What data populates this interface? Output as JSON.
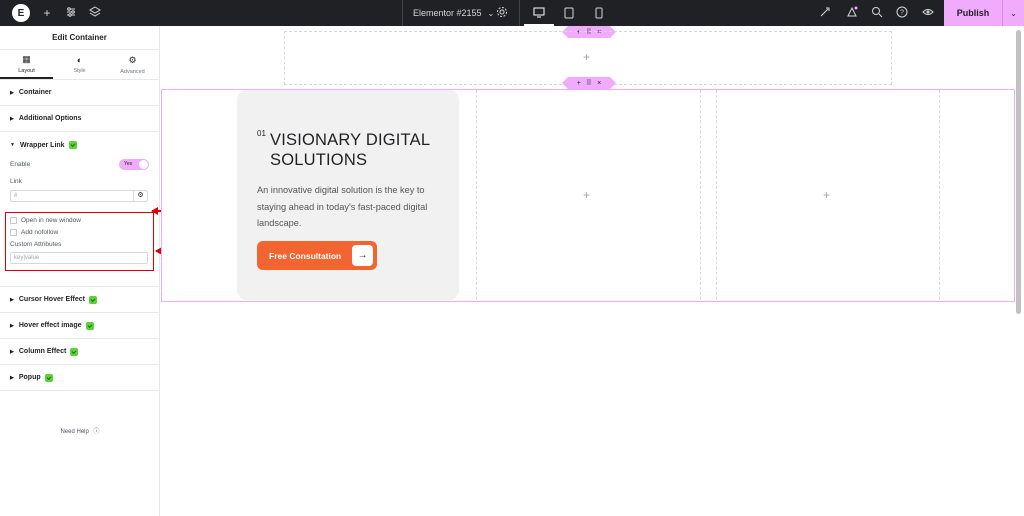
{
  "topbar": {
    "logo_letter": "E",
    "add_icon": "plus-icon",
    "settings_icon": "sliders-icon",
    "layers_icon": "layers-icon",
    "doc_title": "Elementor #2155",
    "doc_chevron": "⌄",
    "page_settings_icon": "gear-icon",
    "devices": [
      "desktop-icon",
      "tablet-icon",
      "mobile-icon"
    ],
    "active_device": "desktop",
    "right_icons": [
      "rocket-icon",
      "notification-icon",
      "search-icon",
      "help-icon",
      "eye-icon"
    ],
    "publish_label": "Publish",
    "publish_menu": "⌄"
  },
  "sidebar": {
    "title": "Edit Container",
    "tabs": [
      {
        "label": "Layout",
        "icon": "▦"
      },
      {
        "label": "Style",
        "icon": "◐"
      },
      {
        "label": "Advanced",
        "icon": "⚙"
      }
    ],
    "sections_top": [
      "Container",
      "Additional Options"
    ],
    "wrapper": {
      "title": "Wrapper Link",
      "enable_label": "Enable",
      "toggle_value": "Yes",
      "link_label": "Link",
      "link_placeholder": "#",
      "open_new_window": "Open in new window",
      "add_nofollow": "Add nofollow",
      "custom_attributes_label": "Custom Attributes",
      "custom_attributes_placeholder": "key|value"
    },
    "sections_bottom": [
      "Cursor Hover Effect",
      "Hover effect image",
      "Column Effect",
      "Popup"
    ],
    "need_help": "Need Help",
    "collapse_glyph": "‹"
  },
  "canvas": {
    "handle_icons": [
      "+",
      "⠿",
      "×"
    ],
    "add_glyph": "+",
    "card": {
      "number": "01",
      "title": "VISIONARY DIGITAL SOLUTIONS",
      "description": "An innovative digital solution is the key to staying ahead in today's fast-paced digital landscape.",
      "cta_label": "Free Consultation",
      "cta_arrow": "→"
    }
  },
  "colors": {
    "accent": "#f0abfc",
    "cta": "#f26430",
    "annotation": "#e10000",
    "pro_badge": "#5bd13a"
  }
}
